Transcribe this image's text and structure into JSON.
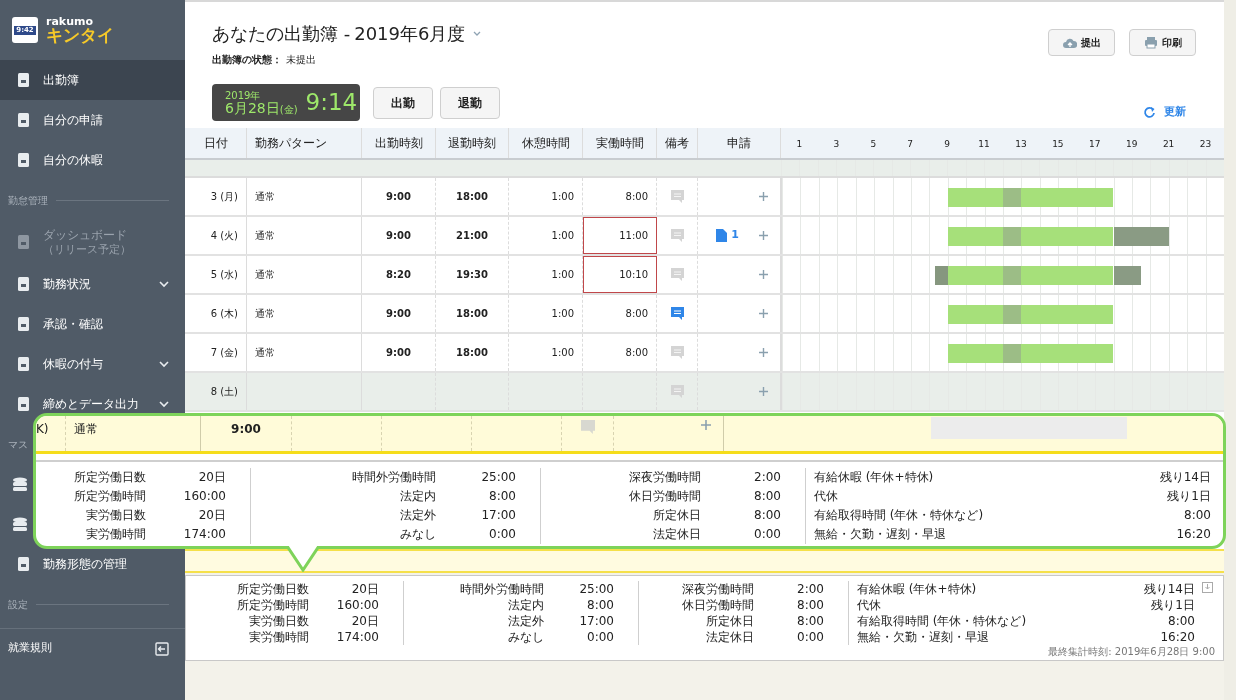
{
  "sidebar": {
    "logo": {
      "clock": "9:42",
      "brand": "rakumo",
      "product": "キンタイ"
    },
    "items": [
      {
        "kind": "item",
        "label": "出勤簿",
        "selected": true
      },
      {
        "kind": "item",
        "label": "自分の申請",
        "selected": false
      },
      {
        "kind": "item",
        "label": "自分の休暇",
        "selected": false
      },
      {
        "kind": "section",
        "label": "勤怠管理"
      },
      {
        "kind": "item",
        "label": "ダッシュボード",
        "sublabel": "（リリース予定）",
        "selected": false,
        "disabled": true
      },
      {
        "kind": "item",
        "label": "勤務状況",
        "selected": false,
        "expandable": true
      },
      {
        "kind": "item",
        "label": "承認・確認",
        "selected": false
      },
      {
        "kind": "item",
        "label": "休暇の付与",
        "selected": false,
        "expandable": true
      },
      {
        "kind": "item",
        "label": "締めとデータ出力",
        "selected": false,
        "expandable": true
      },
      {
        "kind": "section",
        "label": "マス"
      },
      {
        "kind": "icon_only"
      },
      {
        "kind": "icon_only"
      },
      {
        "kind": "item",
        "label": "勤務形態の管理",
        "selected": false
      },
      {
        "kind": "section",
        "label": "設定"
      },
      {
        "kind": "footer",
        "label": "就業規則"
      }
    ]
  },
  "header": {
    "title": "あなたの出勤簿 - ",
    "period": "2019年6月度",
    "status_label": "出勤簿の状態：",
    "status": "未提出",
    "clock": {
      "year": "2019年",
      "date": "6月28日",
      "weekday": "(金)",
      "time": "9:14"
    },
    "punch_buttons": [
      "出勤",
      "退勤"
    ],
    "actions": [
      "提出",
      "印刷"
    ],
    "refresh": "更新"
  },
  "table": {
    "columns": [
      "日付",
      "勤務パターン",
      "出勤時刻",
      "退勤時刻",
      "休憩時間",
      "実働時間",
      "備考",
      "申請"
    ],
    "hours": [
      "1",
      "3",
      "5",
      "7",
      "9",
      "11",
      "13",
      "15",
      "17",
      "19",
      "21",
      "23"
    ],
    "rows": [
      {
        "date": "3 (月)",
        "pattern": "通常",
        "in": "9:00",
        "out": "18:00",
        "break": "1:00",
        "worked": "8:00",
        "flagged": false,
        "note": false,
        "holiday": false
      },
      {
        "date": "4 (火)",
        "pattern": "通常",
        "in": "9:00",
        "out": "21:00",
        "break": "1:00",
        "worked": "11:00",
        "flagged": true,
        "note": false,
        "requests": "1",
        "holiday": false
      },
      {
        "date": "5 (水)",
        "pattern": "通常",
        "in": "8:20",
        "out": "19:30",
        "break": "1:00",
        "worked": "10:10",
        "flagged": true,
        "note": false,
        "holiday": false
      },
      {
        "date": "6 (木)",
        "pattern": "通常",
        "in": "9:00",
        "out": "18:00",
        "break": "1:00",
        "worked": "8:00",
        "flagged": false,
        "note": true,
        "holiday": false
      },
      {
        "date": "7 (金)",
        "pattern": "通常",
        "in": "9:00",
        "out": "18:00",
        "break": "1:00",
        "worked": "8:00",
        "flagged": false,
        "note": false,
        "holiday": false
      },
      {
        "date": "8 (土)",
        "flagged": false,
        "note": false,
        "holiday": true
      }
    ]
  },
  "callout": {
    "row": {
      "date": "K)",
      "pattern": "通常",
      "in": "9:00"
    },
    "summary": [
      [
        {
          "label": "所定労働日数",
          "value": "20日"
        },
        {
          "label": "所定労働時間",
          "value": "160:00"
        },
        {
          "label": "実労働日数",
          "value": "20日"
        },
        {
          "label": "実労働時間",
          "value": "174:00"
        }
      ],
      [
        {
          "label": "時間外労働時間",
          "value": "25:00"
        },
        {
          "label": "法定内",
          "value": "8:00"
        },
        {
          "label": "法定外",
          "value": "17:00"
        },
        {
          "label": "みなし",
          "value": "0:00"
        }
      ],
      [
        {
          "label": "深夜労働時間",
          "value": "2:00"
        },
        {
          "label": "休日労働時間",
          "value": "8:00"
        },
        {
          "label": "所定休日",
          "value": "8:00"
        },
        {
          "label": "法定休日",
          "value": "0:00"
        }
      ],
      [
        {
          "label": "有給休暇 (年休+特休)",
          "value": "残り14日"
        },
        {
          "label": "代休",
          "value": "残り1日"
        },
        {
          "label": "有給取得時間 (年休・特休など)",
          "value": "8:00"
        },
        {
          "label": "無給・欠勤・遅刻・早退",
          "value": "16:20"
        }
      ]
    ]
  },
  "summary": {
    "groups": [
      [
        {
          "label": "所定労働日数",
          "value": "20日"
        },
        {
          "label": "所定労働時間",
          "value": "160:00"
        },
        {
          "label": "実労働日数",
          "value": "20日"
        },
        {
          "label": "実労働時間",
          "value": "174:00"
        }
      ],
      [
        {
          "label": "時間外労働時間",
          "value": "25:00"
        },
        {
          "label": "法定内",
          "value": "8:00"
        },
        {
          "label": "法定外",
          "value": "17:00"
        },
        {
          "label": "みなし",
          "value": "0:00"
        }
      ],
      [
        {
          "label": "深夜労働時間",
          "value": "2:00"
        },
        {
          "label": "休日労働時間",
          "value": "8:00"
        },
        {
          "label": "所定休日",
          "value": "8:00"
        },
        {
          "label": "法定休日",
          "value": "0:00"
        }
      ],
      [
        {
          "label": "有給休暇 (年休+特休)",
          "value": "残り14日"
        },
        {
          "label": "代休",
          "value": "残り1日"
        },
        {
          "label": "有給取得時間 (年休・特休など)",
          "value": "8:00"
        },
        {
          "label": "無給・欠勤・遅刻・早退",
          "value": "16:20"
        }
      ]
    ],
    "last_updated": "最終集計時刻: 2019年6月28日 9:00"
  }
}
